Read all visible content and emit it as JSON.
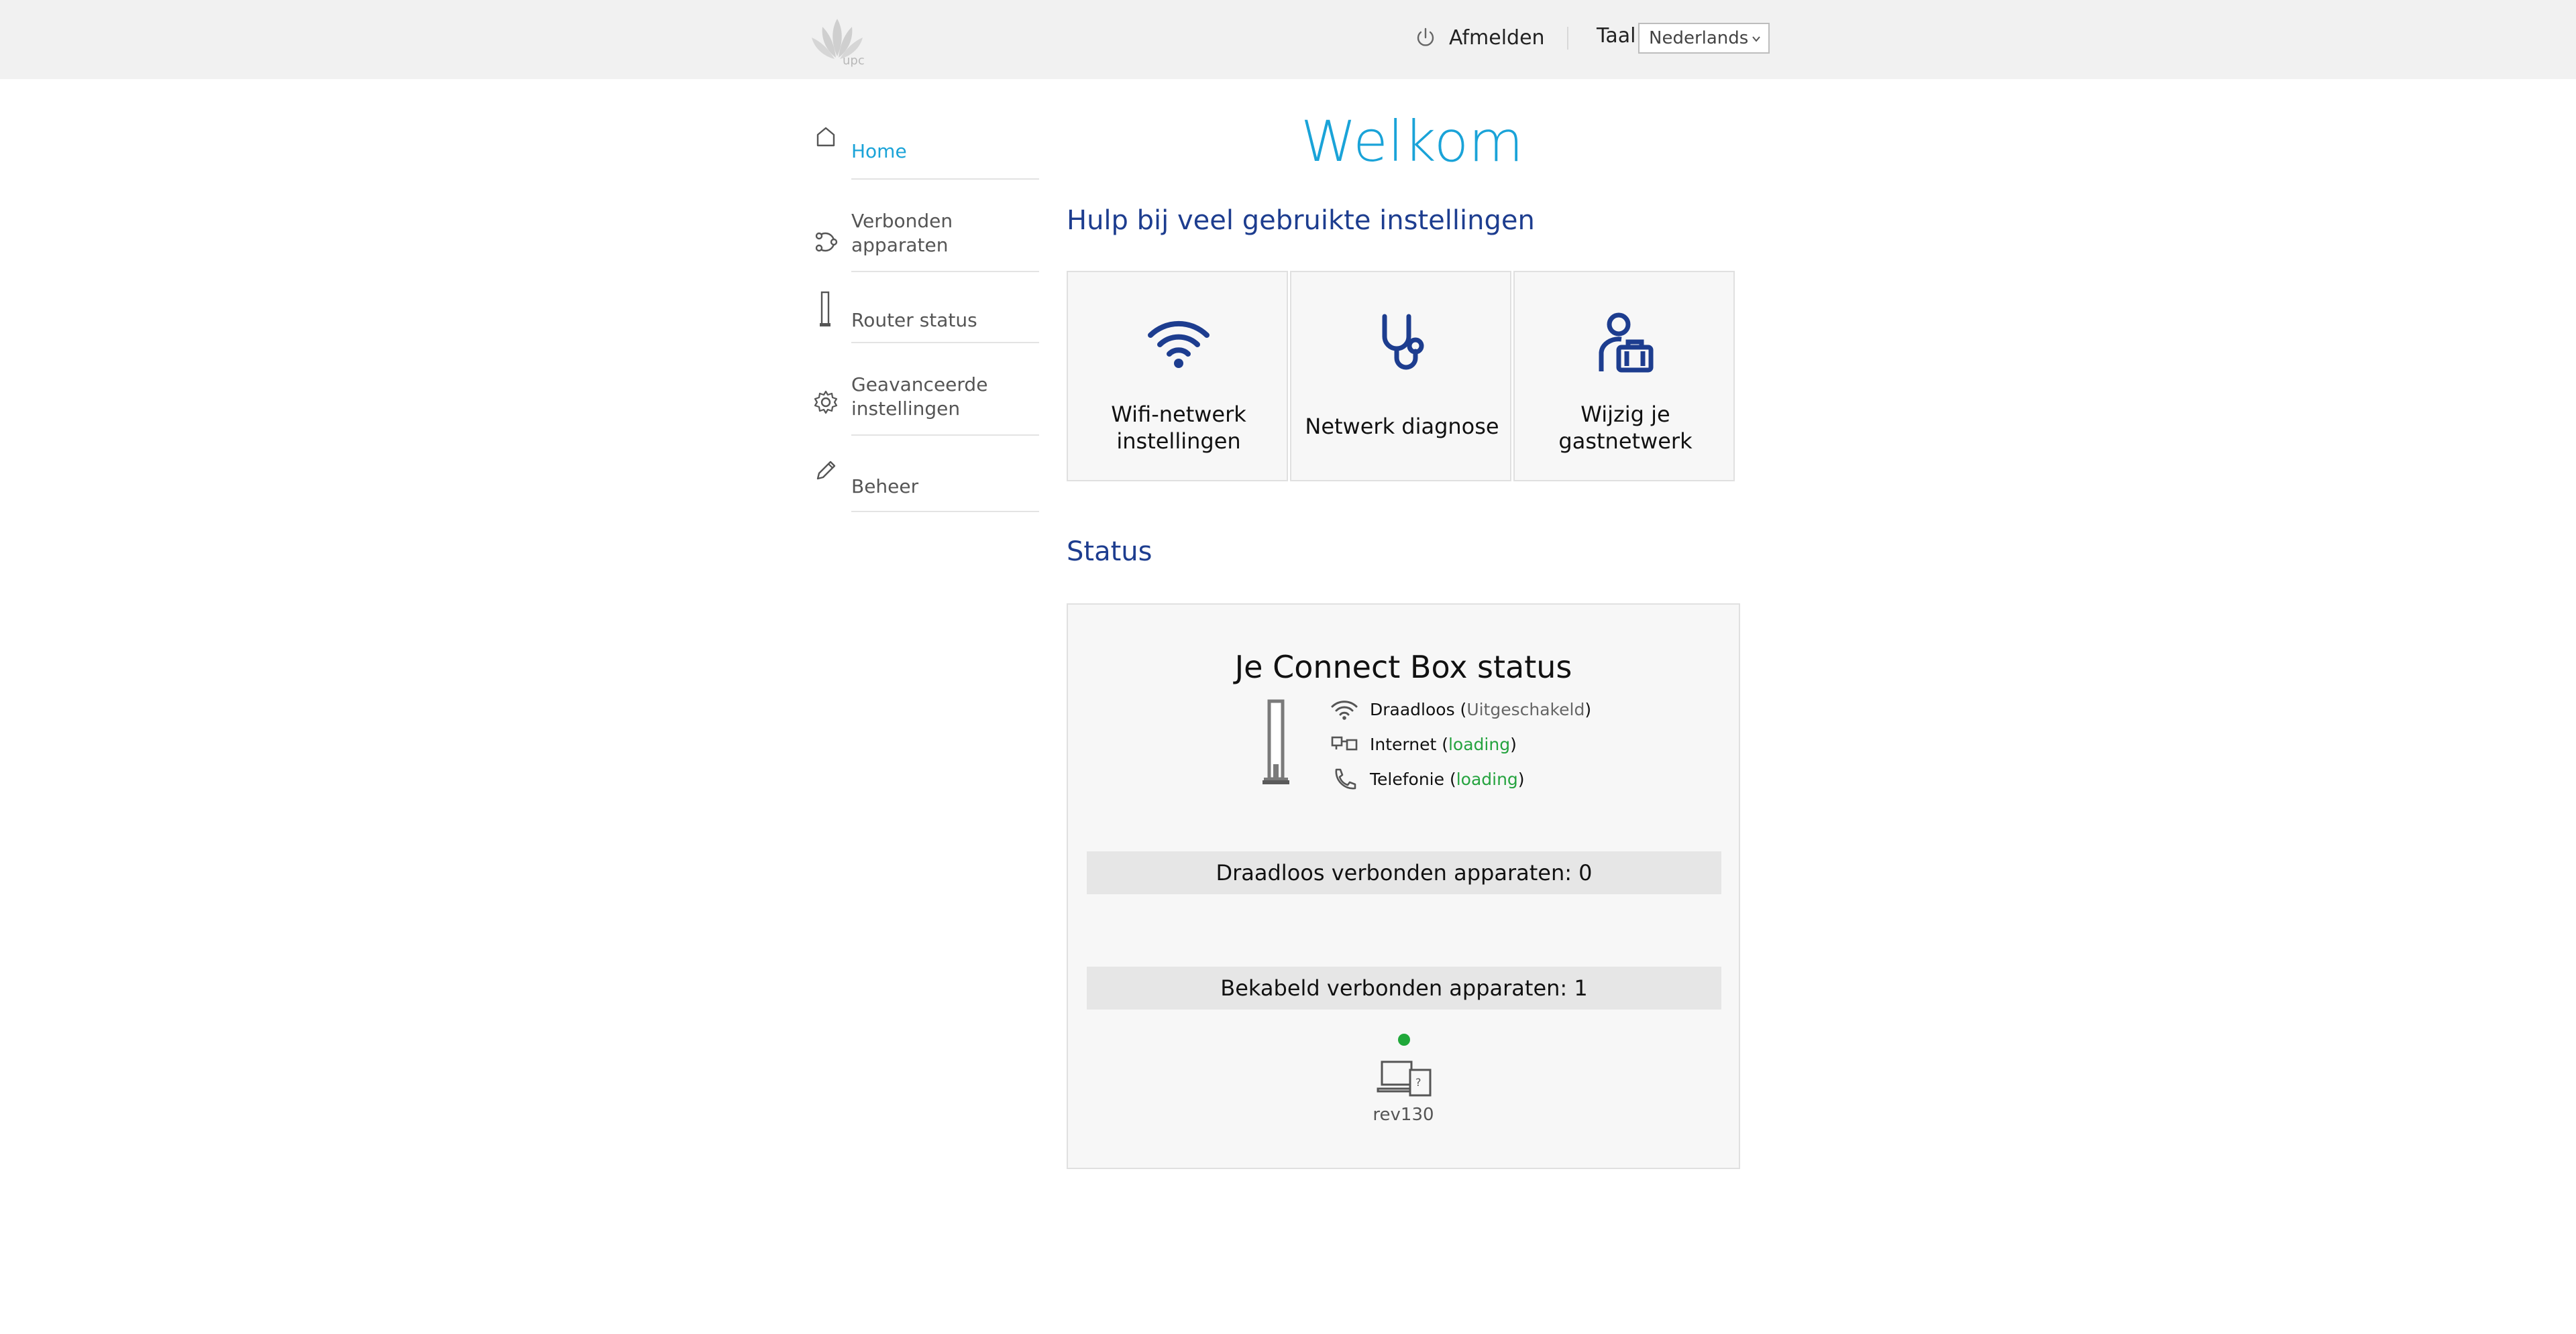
{
  "header": {
    "logo_text": "upc",
    "logout_label": "Afmelden",
    "language_label": "Taal",
    "language_value": "Nederlands"
  },
  "sidebar": {
    "items": [
      {
        "label": "Home",
        "icon": "home-icon",
        "active": true
      },
      {
        "label": "Verbonden apparaten",
        "icon": "devices-icon"
      },
      {
        "label": "Router status",
        "icon": "router-icon"
      },
      {
        "label": "Geavanceerde instellingen",
        "icon": "gear-icon"
      },
      {
        "label": "Beheer",
        "icon": "pencil-icon"
      }
    ]
  },
  "main": {
    "title": "Welkom",
    "help_heading": "Hulp bij veel gebruikte instellingen",
    "tiles": [
      {
        "label": "Wifi-netwerk instellingen",
        "icon": "wifi-icon"
      },
      {
        "label": "Netwerk diagnose",
        "icon": "stethoscope-icon"
      },
      {
        "label": "Wijzig je gastnetwerk",
        "icon": "guest-icon"
      }
    ],
    "status_heading": "Status"
  },
  "status": {
    "title": "Je Connect Box status",
    "rows": [
      {
        "label": "Draadloos",
        "value": "Uitgeschakeld",
        "icon": "wifi-icon"
      },
      {
        "label": "Internet",
        "value": "loading",
        "icon": "internet-icon"
      },
      {
        "label": "Telefonie",
        "value": "loading",
        "icon": "phone-icon"
      }
    ],
    "wireless_devices": "Draadloos verbonden apparaten: 0",
    "wired_devices": "Bekabeld verbonden apparaten: 1",
    "device": {
      "name": "rev130",
      "online": true
    }
  },
  "colors": {
    "accent": "#1aa3d8",
    "heading_blue": "#1d3d8f",
    "status_green": "#25a33f"
  }
}
